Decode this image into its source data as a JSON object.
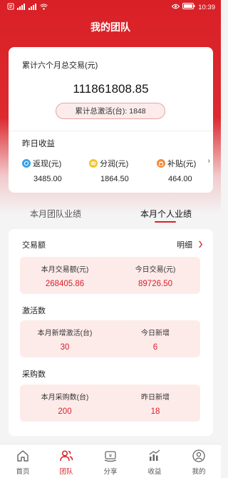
{
  "status": {
    "time": "10:39",
    "battery": "100"
  },
  "nav": {
    "title": "我的团队"
  },
  "summary": {
    "six_month_label": "累计六个月总交易(元)",
    "six_month_amount": "111861808.85",
    "activation_text": "累计总激活(台): 1848",
    "yesterday_title": "昨日收益",
    "items": [
      {
        "icon": "rebate-icon",
        "label": "返现(元)",
        "value": "3485.00"
      },
      {
        "icon": "profit-share-icon",
        "label": "分润(元)",
        "value": "1864.50"
      },
      {
        "icon": "subsidy-icon",
        "label": "补贴(元)",
        "value": "464.00"
      }
    ]
  },
  "tabs": {
    "team": "本月团队业绩",
    "personal": "本月个人业绩"
  },
  "sections": {
    "transaction": {
      "title": "交易额",
      "detail": "明细",
      "left_label": "本月交易额(元)",
      "left_value": "268405.86",
      "right_label": "今日交易(元)",
      "right_value": "89726.50"
    },
    "activation": {
      "title": "激活数",
      "left_label": "本月新增激活(台)",
      "left_value": "30",
      "right_label": "今日新增",
      "right_value": "6"
    },
    "purchase": {
      "title": "采购数",
      "left_label": "本月采购数(台)",
      "left_value": "200",
      "right_label": "昨日新增",
      "right_value": "18"
    }
  },
  "tabbar": {
    "home": "首页",
    "team": "团队",
    "share": "分享",
    "income": "收益",
    "mine": "我的"
  },
  "colors": {
    "brand": "#d92027",
    "stat_bg": "#fdebea"
  }
}
